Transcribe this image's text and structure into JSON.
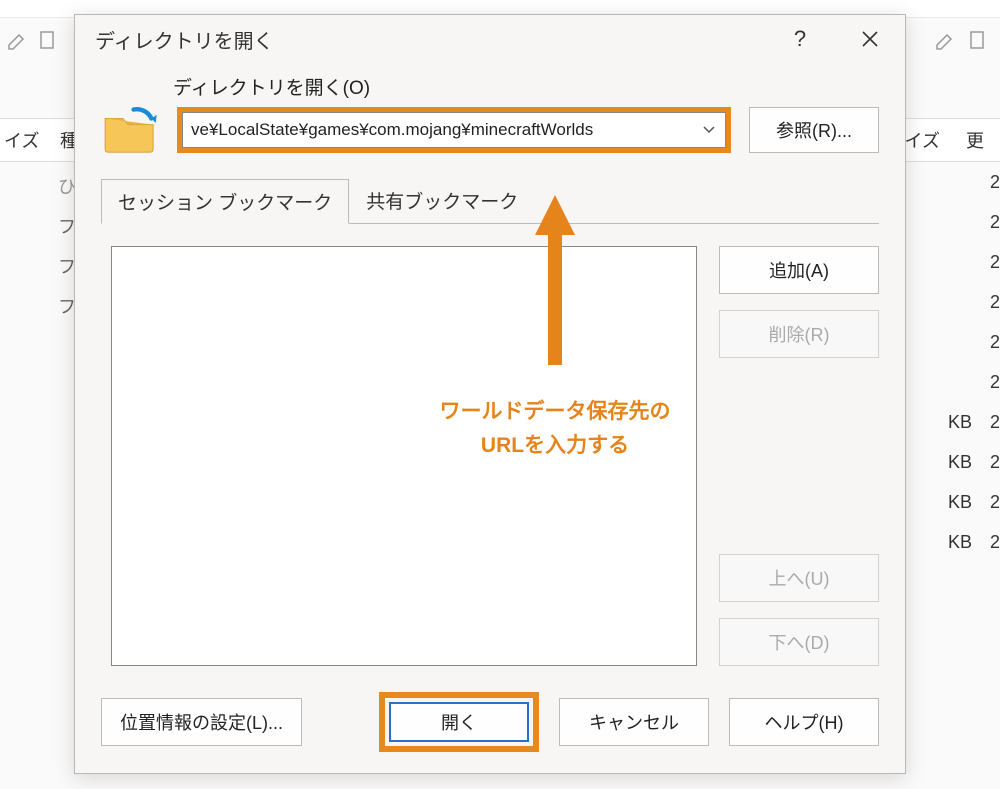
{
  "background": {
    "header_cols": {
      "size": "イズ",
      "type": "種類",
      "size2": "イズ",
      "upd": "更"
    },
    "rows_left": [
      "ひと",
      "ファ",
      "ファ",
      "ファ"
    ],
    "rows_right": [
      {
        "kb": "",
        "v": "2"
      },
      {
        "kb": "",
        "v": "2"
      },
      {
        "kb": "",
        "v": "2"
      },
      {
        "kb": "",
        "v": "2"
      },
      {
        "kb": "",
        "v": "2"
      },
      {
        "kb": "",
        "v": "2"
      },
      {
        "kb": "KB",
        "v": "2"
      },
      {
        "kb": "KB",
        "v": "2"
      },
      {
        "kb": "KB",
        "v": "2"
      },
      {
        "kb": "KB",
        "v": "2"
      }
    ]
  },
  "dialog": {
    "title": "ディレクトリを開く",
    "open_label": "ディレクトリを開く(O)",
    "path_value": "ve¥LocalState¥games¥com.mojang¥minecraftWorlds",
    "browse": "参照(R)...",
    "tabs": {
      "session": "セッション ブックマーク",
      "shared": "共有ブックマーク"
    },
    "side": {
      "add": "追加(A)",
      "remove": "削除(R)",
      "up": "上へ(U)",
      "down": "下へ(D)"
    },
    "bottom": {
      "location": "位置情報の設定(L)...",
      "open": "開く",
      "cancel": "キャンセル",
      "help": "ヘルプ(H)"
    }
  },
  "annotation": {
    "line1": "ワールドデータ保存先の",
    "line2": "URLを入力する"
  }
}
